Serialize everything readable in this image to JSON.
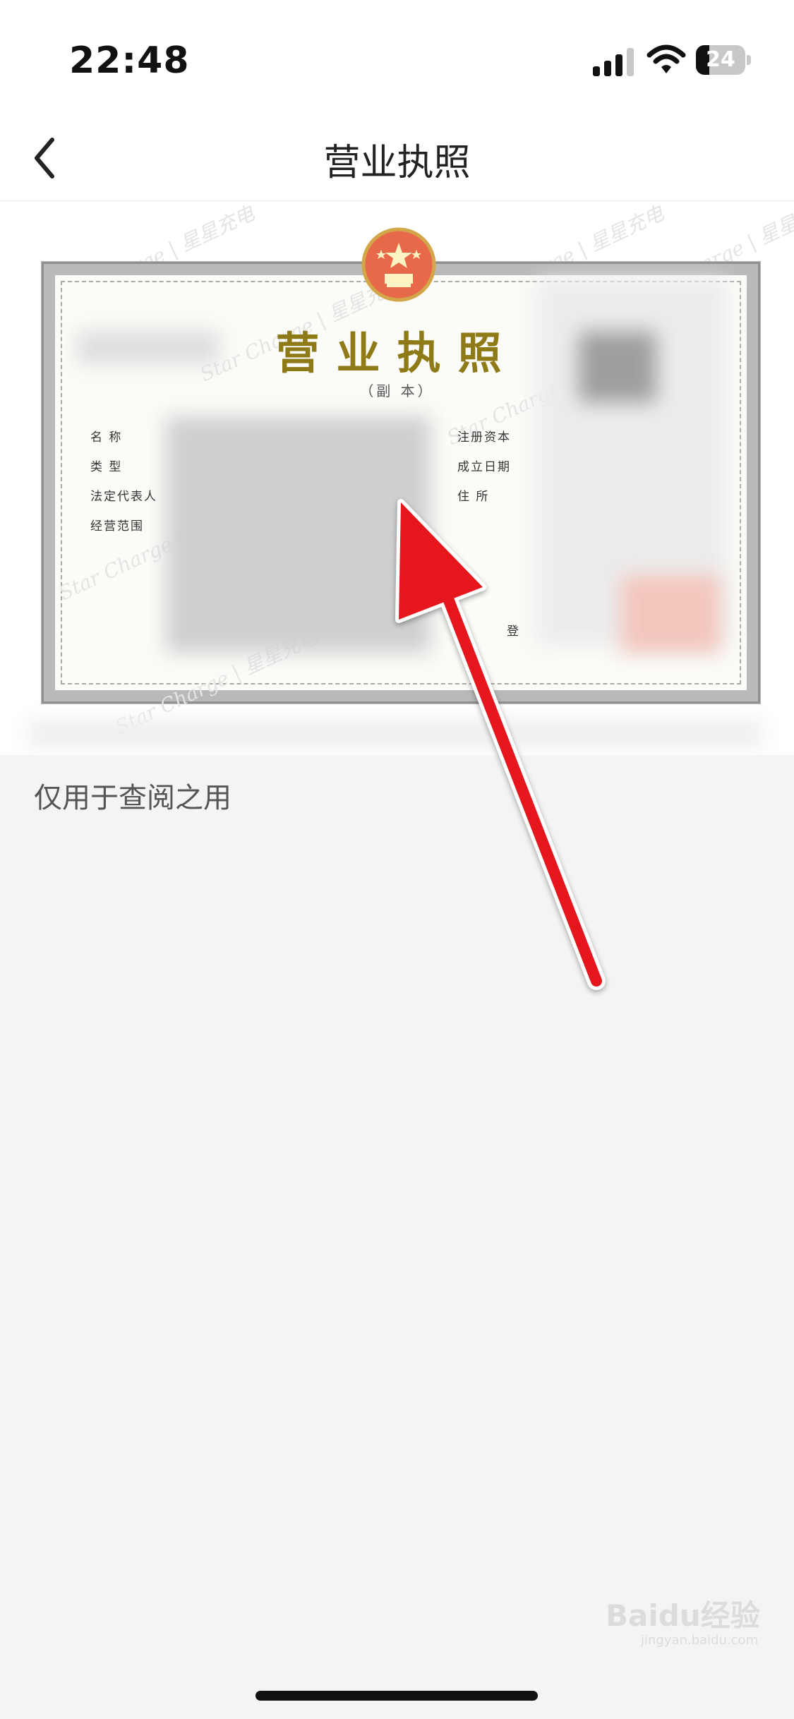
{
  "status_bar": {
    "time": "22:48",
    "battery": "24",
    "signal_icon": "cellular-signal-icon",
    "wifi_icon": "wifi-icon",
    "battery_icon": "battery-icon"
  },
  "nav": {
    "title": "营业执照",
    "back_icon": "chevron-left-icon"
  },
  "license": {
    "watermark_text": "Star Charge | 星星充电",
    "title": "营业执照",
    "subtitle": "（副 本）",
    "fields_left": [
      "名      称",
      "类      型",
      "法定代表人",
      "经营范围"
    ],
    "fields_right": [
      "注册资本",
      "成立日期",
      "住      所"
    ],
    "registration_label": "登"
  },
  "caption": "仅用于查阅之用",
  "annotation": {
    "arrow_color": "#e5141d"
  },
  "watermark": {
    "brand": "Baidu经验",
    "url": "jingyan.baidu.com"
  }
}
